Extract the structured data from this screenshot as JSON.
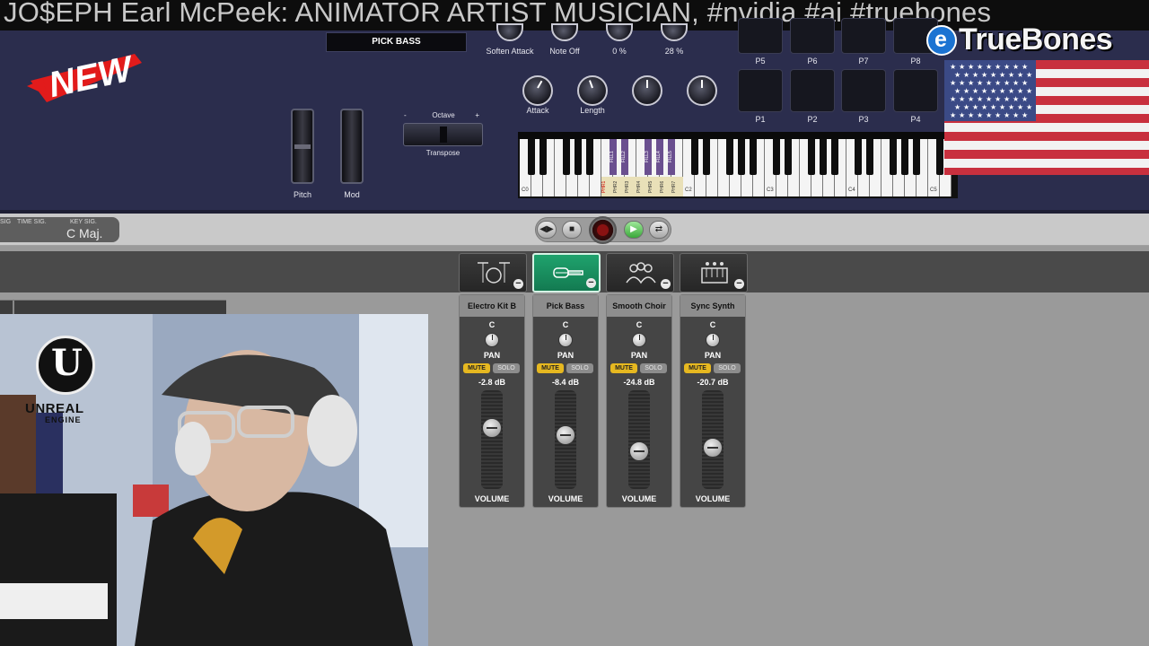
{
  "banner": {
    "text": "JO$EPH Earl McPeek: ANIMATOR ARTIST MUSICIAN, #nvidia #ai #truebones"
  },
  "badge": {
    "text": "NEW"
  },
  "instrument_panel": {
    "patch_name": "PICK BASS",
    "top_knobs": [
      {
        "label": "Soften Attack"
      },
      {
        "label": "Note Off"
      },
      {
        "label": "0 %"
      },
      {
        "label": "28 %"
      }
    ],
    "mid_knobs": [
      {
        "label": "Attack"
      },
      {
        "label": "Length"
      },
      {
        "label": ""
      },
      {
        "label": ""
      }
    ],
    "wheels": {
      "pitch_label": "Pitch",
      "mod_label": "Mod"
    },
    "octave": {
      "label": "Octave",
      "minus": "-",
      "plus": "+",
      "transpose_label": "Transpose"
    },
    "piano": {
      "octave_labels": [
        "C0",
        "C1",
        "C2",
        "C3",
        "C4",
        "C5"
      ],
      "fill_labels": [
        "FILL1",
        "FILL2",
        "FILL3",
        "FILL4",
        "FILL5"
      ],
      "phrase_labels": [
        "PHR1",
        "PHR2",
        "PHR3",
        "PHR4",
        "PHR5",
        "PHR6",
        "PHR7"
      ]
    },
    "pads_top": [
      "P5",
      "P6",
      "P7",
      "P8"
    ],
    "pads_bottom": [
      "P1",
      "P2",
      "P3",
      "P4"
    ]
  },
  "brand": {
    "logo_text": "TrueBones"
  },
  "control_bar": {
    "time_sig_caption": "TIME SIG.",
    "key_sig_caption": "KEY SIG.",
    "sig_caption": "SIG",
    "key_value": "C  Maj."
  },
  "instruments": [
    {
      "name": "Electro Kit B",
      "icon": "drum-kit-icon",
      "selected": false
    },
    {
      "name": "Pick Bass",
      "icon": "bass-guitar-icon",
      "selected": true
    },
    {
      "name": "Smooth Choir",
      "icon": "choir-icon",
      "selected": false
    },
    {
      "name": "Sync Synth",
      "icon": "synth-icon",
      "selected": false
    }
  ],
  "channels": [
    {
      "name": "Electro Kit B",
      "pan_value": "C",
      "pan_label": "PAN",
      "mute": "MUTE",
      "solo": "SOLO",
      "db": "-2.8 dB",
      "volume_label": "VOLUME",
      "volume_level": 0.62
    },
    {
      "name": "Pick Bass",
      "pan_value": "C",
      "pan_label": "PAN",
      "mute": "MUTE",
      "solo": "SOLO",
      "db": "-8.4 dB",
      "volume_label": "VOLUME",
      "volume_level": 0.55
    },
    {
      "name": "Smooth Choir",
      "pan_value": "C",
      "pan_label": "PAN",
      "mute": "MUTE",
      "solo": "SOLO",
      "db": "-24.8 dB",
      "volume_label": "VOLUME",
      "volume_level": 0.38
    },
    {
      "name": "Sync Synth",
      "pan_value": "C",
      "pan_label": "PAN",
      "mute": "MUTE",
      "solo": "SOLO",
      "db": "-20.7 dB",
      "volume_label": "VOLUME",
      "volume_level": 0.42
    }
  ],
  "webcam_overlay": {
    "ue_line1": "UNREAL",
    "ue_line2": "ENGINE"
  },
  "colors": {
    "panel": "#2b2d4d",
    "accent_green": "#1a9b67",
    "mute_yellow": "#e6b820"
  }
}
